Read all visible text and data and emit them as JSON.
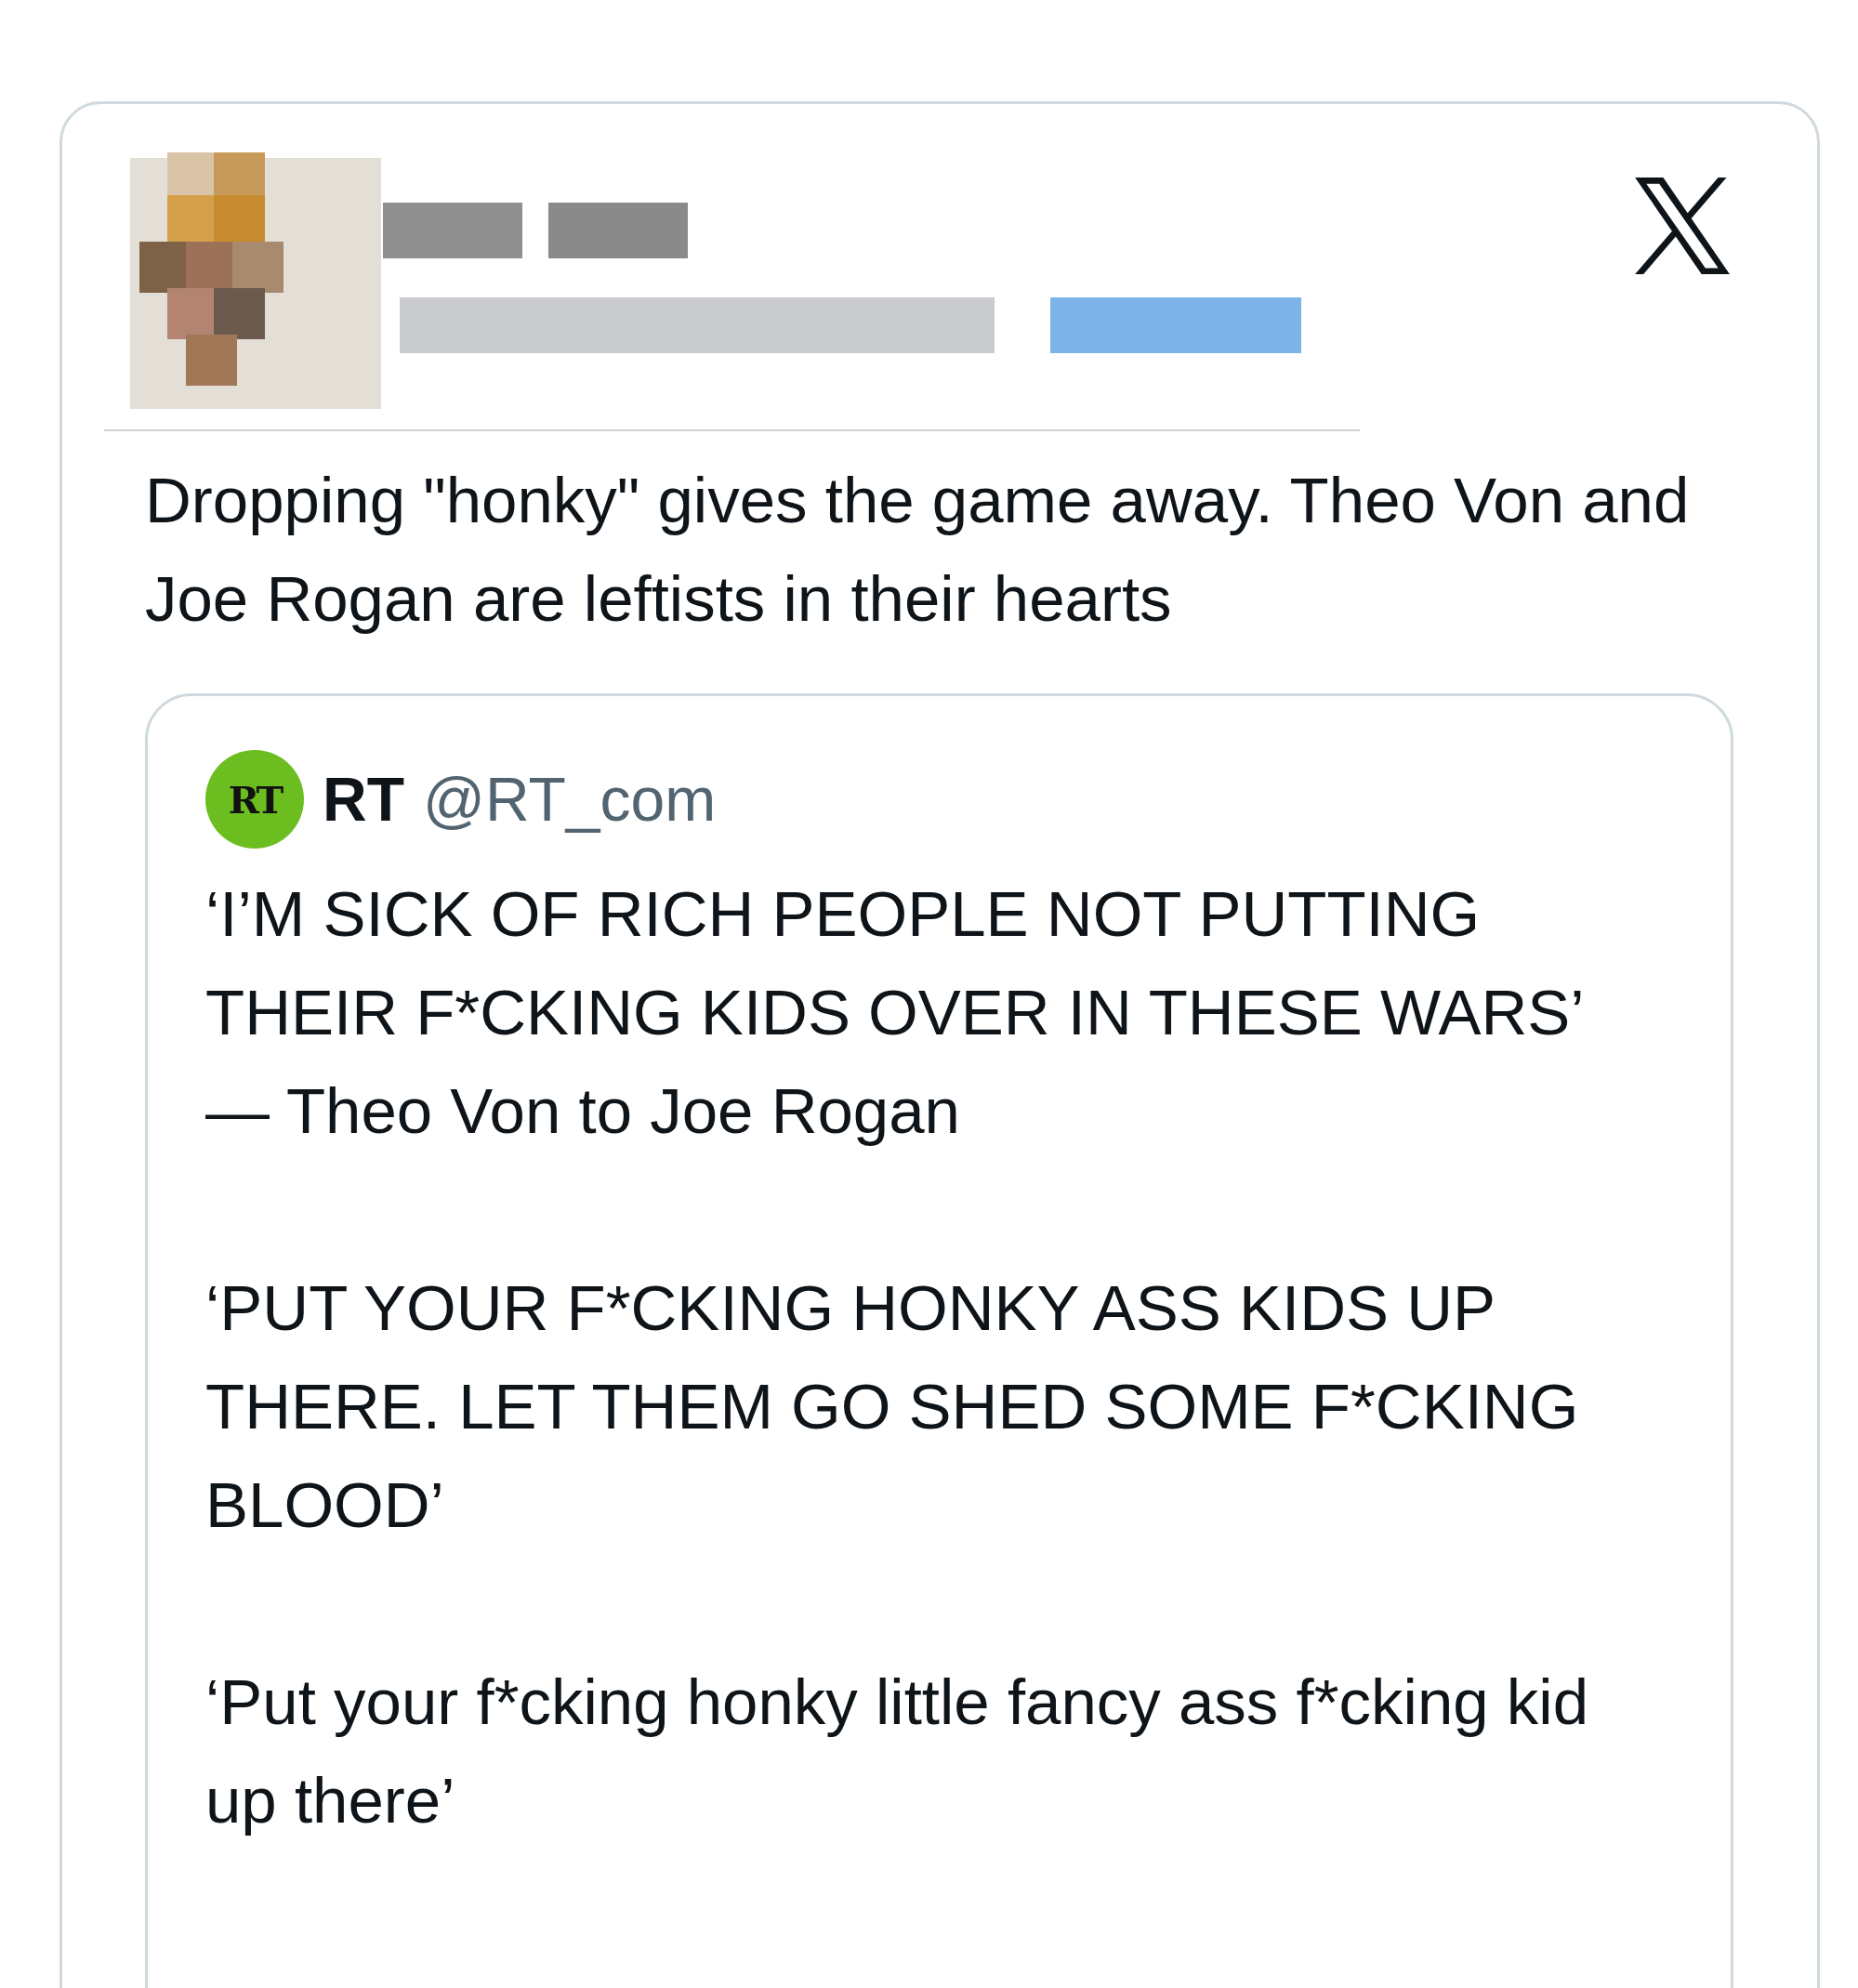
{
  "post": {
    "text": "Dropping \"honky\" gives the game away. Theo Von and Joe Rogan are leftists in their hearts",
    "quoted": {
      "avatar_label": "RT",
      "name": "RT",
      "handle": "@RT_com",
      "paragraphs": [
        "‘I’M SICK OF RICH PEOPLE NOT PUTTING THEIR F*CKING KIDS OVER IN THESE WARS’ — Theo Von to Joe Rogan",
        "‘PUT YOUR F*CKING HONKY ASS KIDS UP THERE. LET THEM GO SHED SOME F*CKING BLOOD’",
        "‘Put your f*cking honky little fancy ass f*cking kid up there’"
      ]
    }
  }
}
